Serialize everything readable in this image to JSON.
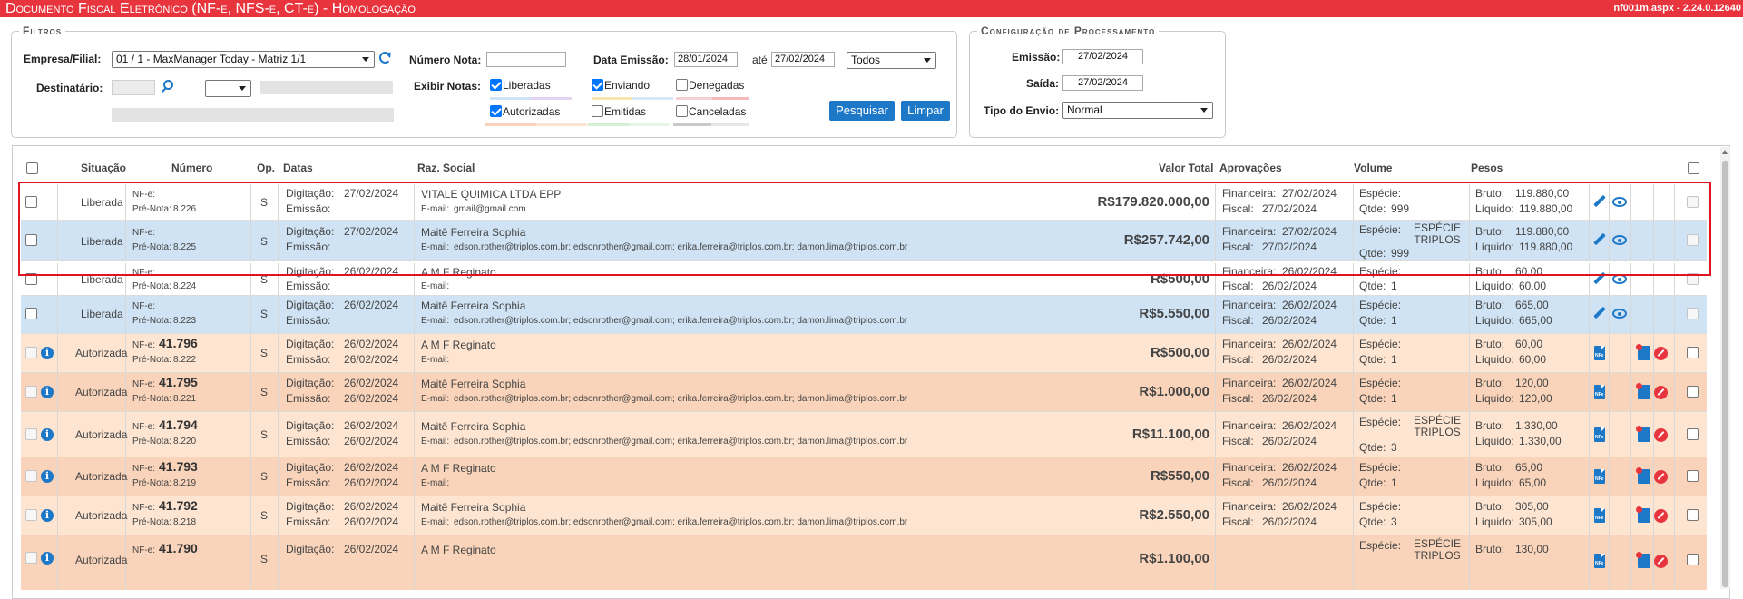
{
  "titlebar": {
    "title": "Documento Fiscal Eletrônico (NF-e, NFS-e, CT-e) - Homologação",
    "version": "nf001m.aspx - 2.24.0.12640"
  },
  "filtros": {
    "legend": "Filtros",
    "empresa_label": "Empresa/Filial:",
    "empresa_value": "01 / 1 - MaxManager Today - Matriz 1/1",
    "numero_nota_label": "Número Nota:",
    "numero_nota_value": "",
    "data_emissao_label": "Data Emissão:",
    "data_from": "28/01/2024",
    "ate_label": "até",
    "data_to": "27/02/2024",
    "periodo_value": "Todos",
    "destinatario_label": "Destinatário:",
    "exibir_label": "Exibir Notas:",
    "options": {
      "liberadas": "Liberadas",
      "enviando": "Enviando",
      "denegadas": "Denegadas",
      "autorizadas": "Autorizadas",
      "emitidas": "Emitidas",
      "canceladas": "Canceladas"
    },
    "pesquisar": "Pesquisar",
    "limpar": "Limpar"
  },
  "config": {
    "legend": "Configuração de Processamento",
    "emissao_label": "Emissão:",
    "emissao_value": "27/02/2024",
    "saida_label": "Saída:",
    "saida_value": "27/02/2024",
    "tipo_label": "Tipo do Envio:",
    "tipo_value": "Normal"
  },
  "colors": {
    "titlebar": "#e8343d",
    "accent": "#1e78c8",
    "row_blue": "#cfe3f4",
    "row_orange_light": "#fde5d2",
    "row_orange_dark": "#f9d4ba",
    "highlight_border": "#e0141e"
  },
  "grid": {
    "headers": {
      "situacao": "Situação",
      "numero": "Número",
      "op": "Op.",
      "datas": "Datas",
      "razao": "Raz. Social",
      "valor": "Valor Total",
      "aprovacoes": "Aprovações",
      "volume": "Volume",
      "pesos": "Pesos"
    },
    "labels": {
      "nfe": "NF-e:",
      "pre_nota": "Pré-Nota:",
      "digitacao": "Digitação:",
      "emissao": "Emissão:",
      "email": "E-mail:",
      "financeira": "Financeira:",
      "fiscal": "Fiscal:",
      "especie": "Espécie:",
      "qtde": "Qtde:",
      "bruto": "Bruto:",
      "liquido": "Líquido:"
    },
    "rows": [
      {
        "situacao": "Liberada",
        "nfe": "",
        "prenota": "8.226",
        "op": "S",
        "digitacao": "27/02/2024",
        "emissao": "",
        "razao": "VITALE QUIMICA LTDA EPP",
        "email": "gmail@gmail.com",
        "valor": "R$179.820.000,00",
        "financeira": "27/02/2024",
        "fiscal": "27/02/2024",
        "especie": "",
        "qtde": "999",
        "bruto": "119.880,00",
        "liquido": "119.880,00"
      },
      {
        "situacao": "Liberada",
        "nfe": "",
        "prenota": "8.225",
        "op": "S",
        "digitacao": "27/02/2024",
        "emissao": "",
        "razao": "Maitê Ferreira Sophia",
        "email": "edson.rother@triplos.com.br; edsonrother@gmail.com; erika.ferreira@triplos.com.br; damon.lima@triplos.com.br",
        "valor": "R$257.742,00",
        "financeira": "27/02/2024",
        "fiscal": "27/02/2024",
        "especie": "ESPÉCIE TRIPLOS",
        "qtde": "999",
        "bruto": "119.880,00",
        "liquido": "119.880,00"
      },
      {
        "situacao": "Liberada",
        "nfe": "",
        "prenota": "8.224",
        "op": "S",
        "digitacao": "26/02/2024",
        "emissao": "",
        "razao": "A M F Reginato",
        "email": "",
        "valor": "R$500,00",
        "financeira": "26/02/2024",
        "fiscal": "26/02/2024",
        "especie": "",
        "qtde": "1",
        "bruto": "60,00",
        "liquido": "60,00"
      },
      {
        "situacao": "Liberada",
        "nfe": "",
        "prenota": "8.223",
        "op": "S",
        "digitacao": "26/02/2024",
        "emissao": "",
        "razao": "Maitê Ferreira Sophia",
        "email": "edson.rother@triplos.com.br; edsonrother@gmail.com; erika.ferreira@triplos.com.br; damon.lima@triplos.com.br",
        "valor": "R$5.550,00",
        "financeira": "26/02/2024",
        "fiscal": "26/02/2024",
        "especie": "",
        "qtde": "1",
        "bruto": "665,00",
        "liquido": "665,00"
      },
      {
        "situacao": "Autorizada",
        "nfe": "41.796",
        "prenota": "8.222",
        "op": "S",
        "digitacao": "26/02/2024",
        "emissao": "26/02/2024",
        "razao": "A M F Reginato",
        "email": "",
        "valor": "R$500,00",
        "financeira": "26/02/2024",
        "fiscal": "26/02/2024",
        "especie": "",
        "qtde": "1",
        "bruto": "60,00",
        "liquido": "60,00"
      },
      {
        "situacao": "Autorizada",
        "nfe": "41.795",
        "prenota": "8.221",
        "op": "S",
        "digitacao": "26/02/2024",
        "emissao": "26/02/2024",
        "razao": "Maitê Ferreira Sophia",
        "email": "edson.rother@triplos.com.br; edsonrother@gmail.com; erika.ferreira@triplos.com.br; damon.lima@triplos.com.br",
        "valor": "R$1.000,00",
        "financeira": "26/02/2024",
        "fiscal": "26/02/2024",
        "especie": "",
        "qtde": "1",
        "bruto": "120,00",
        "liquido": "120,00"
      },
      {
        "situacao": "Autorizada",
        "nfe": "41.794",
        "prenota": "8.220",
        "op": "S",
        "digitacao": "26/02/2024",
        "emissao": "26/02/2024",
        "razao": "Maitê Ferreira Sophia",
        "email": "edson.rother@triplos.com.br; edsonrother@gmail.com; erika.ferreira@triplos.com.br; damon.lima@triplos.com.br",
        "valor": "R$11.100,00",
        "financeira": "26/02/2024",
        "fiscal": "26/02/2024",
        "especie": "ESPÉCIE TRIPLOS",
        "qtde": "3",
        "bruto": "1.330,00",
        "liquido": "1.330,00"
      },
      {
        "situacao": "Autorizada",
        "nfe": "41.793",
        "prenota": "8.219",
        "op": "S",
        "digitacao": "26/02/2024",
        "emissao": "26/02/2024",
        "razao": "A M F Reginato",
        "email": "",
        "valor": "R$550,00",
        "financeira": "26/02/2024",
        "fiscal": "26/02/2024",
        "especie": "",
        "qtde": "1",
        "bruto": "65,00",
        "liquido": "65,00"
      },
      {
        "situacao": "Autorizada",
        "nfe": "41.792",
        "prenota": "8.218",
        "op": "S",
        "digitacao": "26/02/2024",
        "emissao": "26/02/2024",
        "razao": "Maitê Ferreira Sophia",
        "email": "edson.rother@triplos.com.br; edsonrother@gmail.com; erika.ferreira@triplos.com.br; damon.lima@triplos.com.br",
        "valor": "R$2.550,00",
        "financeira": "26/02/2024",
        "fiscal": "26/02/2024",
        "especie": "",
        "qtde": "3",
        "bruto": "305,00",
        "liquido": "305,00"
      },
      {
        "situacao": "Autorizada",
        "nfe": "41.790",
        "prenota": "",
        "op": "S",
        "digitacao": "26/02/2024",
        "emissao": "",
        "razao": "A M F Reginato",
        "email": "",
        "valor": "R$1.100,00",
        "financeira": "",
        "fiscal": "",
        "especie": "ESPÉCIE TRIPLOS",
        "qtde": "",
        "bruto": "130,00",
        "liquido": ""
      }
    ]
  }
}
